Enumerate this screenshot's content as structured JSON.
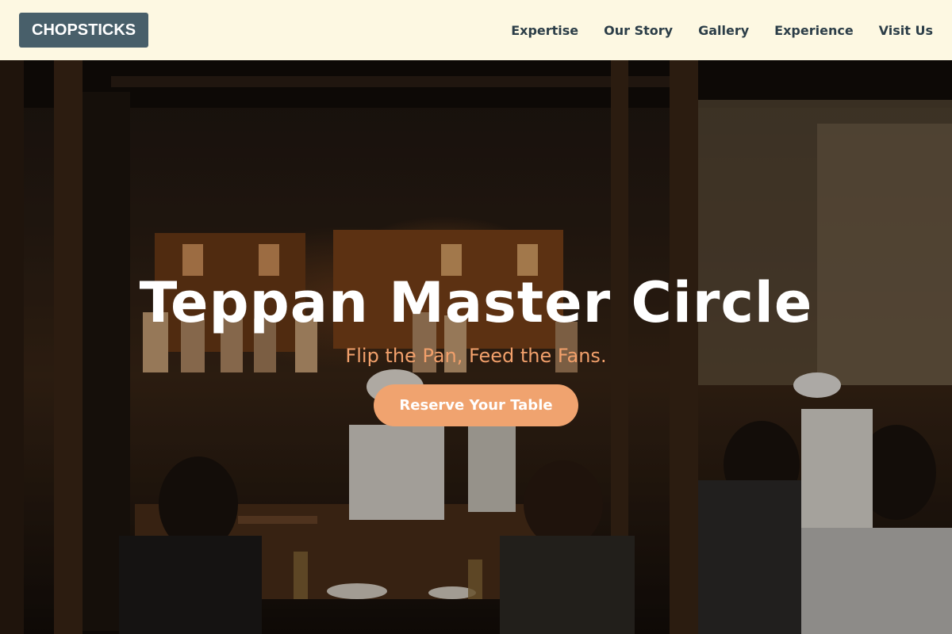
{
  "brand": {
    "logo_text": "CHOPSTICKS"
  },
  "nav": {
    "links": [
      {
        "label": "Expertise"
      },
      {
        "label": "Our Story"
      },
      {
        "label": "Gallery"
      },
      {
        "label": "Experience"
      },
      {
        "label": "Visit Us"
      }
    ]
  },
  "hero": {
    "title": "Teppan Master Circle",
    "subtitle": "Flip the Pan, Feed the Fans.",
    "cta_label": "Reserve Your Table",
    "background_image": "restaurant-interior-photo"
  },
  "colors": {
    "navbar_bg": "#fdf8e2",
    "logo_bg": "#485f6a",
    "nav_text": "#2c3e48",
    "accent": "#f0a36f",
    "subtitle": "#f2a06b"
  }
}
